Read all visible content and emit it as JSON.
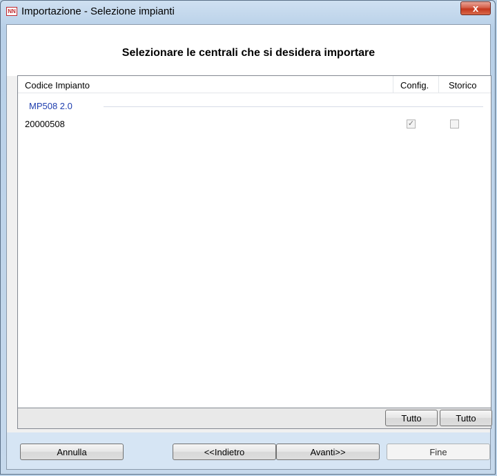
{
  "window": {
    "title": "Importazione - Selezione impianti",
    "icon": "app-logo-icon",
    "close_glyph": "x"
  },
  "heading": "Selezionare le centrali che si desidera importare",
  "list": {
    "columns": [
      "Codice Impianto",
      "Config.",
      "Storico"
    ],
    "groups": [
      {
        "name": "MP508 2.0",
        "rows": [
          {
            "code": "20000508",
            "config_checked": true,
            "storico_checked": false
          }
        ]
      }
    ]
  },
  "select_all": {
    "config_label": "Tutto",
    "storico_label": "Tutto"
  },
  "footer": {
    "cancel_label": "Annulla",
    "back_label": "<<Indietro",
    "next_label": "Avanti>>",
    "finish_label": "Fine"
  },
  "colors": {
    "group_text": "#1e3dae",
    "close_button": "#c4371d"
  }
}
